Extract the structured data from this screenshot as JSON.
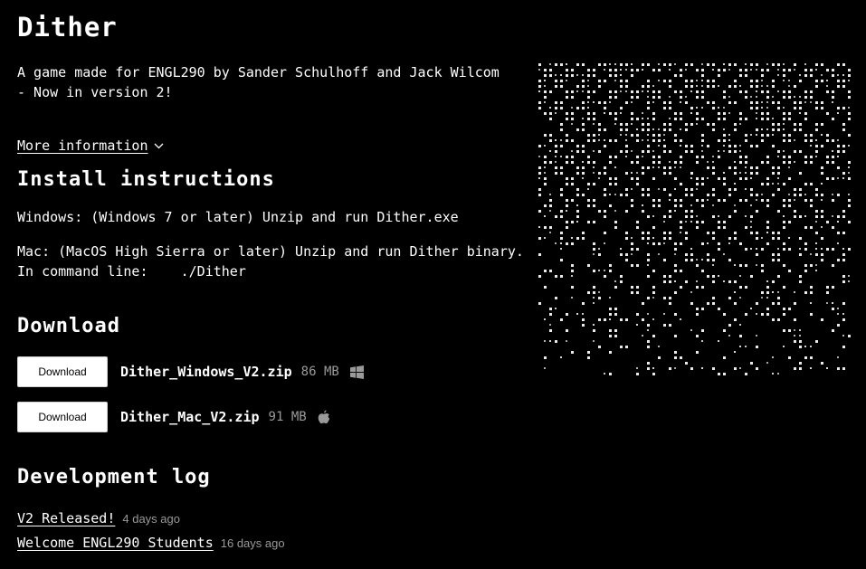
{
  "title": "Dither",
  "description": "A game made for ENGL290 by Sander Schulhoff and Jack Wilcom - Now in version 2!",
  "more_info": "More information",
  "install": {
    "heading": "Install instructions",
    "windows": "Windows: (Windows 7 or later) Unzip and run Dither.exe",
    "mac_line1": "Mac: (MacOS High Sierra or later) Unzip and run Dither binary.",
    "mac_line2": "In command line:    ./Dither"
  },
  "download": {
    "heading": "Download",
    "button_label": "Download",
    "files": [
      {
        "name": "Dither_Windows_V2.zip",
        "size": "86 MB",
        "icon": "windows-icon"
      },
      {
        "name": "Dither_Mac_V2.zip",
        "size": "91 MB",
        "icon": "apple-icon"
      }
    ]
  },
  "devlog": {
    "heading": "Development log",
    "entries": [
      {
        "title": "V2 Released!",
        "ago": "4 days ago"
      },
      {
        "title": "Welcome ENGL290 Students",
        "ago": "16 days ago"
      }
    ]
  },
  "colors": {
    "background": "#000000",
    "text": "#ffffff",
    "muted": "#9a9a9a"
  }
}
